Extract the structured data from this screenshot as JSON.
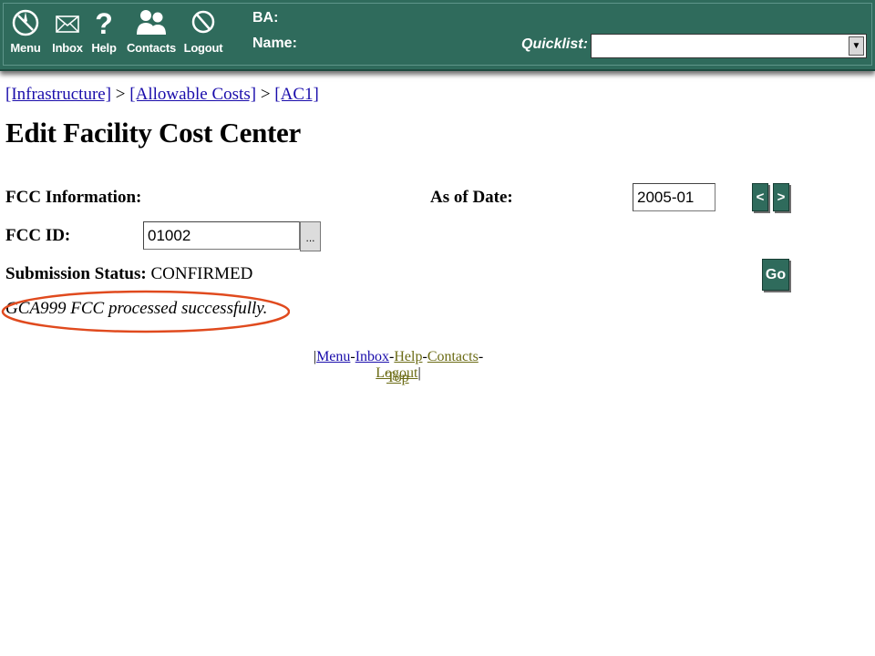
{
  "nav": {
    "items": [
      {
        "label": "Menu",
        "icon": "compass-icon"
      },
      {
        "label": "Inbox",
        "icon": "envelope-icon"
      },
      {
        "label": "Help",
        "icon": "question-icon"
      },
      {
        "label": "Contacts",
        "icon": "people-icon"
      },
      {
        "label": "Logout",
        "icon": "no-entry-icon"
      }
    ]
  },
  "header": {
    "ba_label": "BA:",
    "name_label": "Name:",
    "quicklist_label": "Quicklist:",
    "quicklist_value": ""
  },
  "breadcrumb": {
    "items": [
      "[Infrastructure]",
      "[Allowable Costs]",
      "[AC1]"
    ],
    "separator": ">"
  },
  "page": {
    "title": "Edit Facility Cost Center"
  },
  "form": {
    "fcc_info_label": "FCC Information:",
    "as_of_date_label": "As of Date:",
    "as_of_date_value": "2005-01",
    "prev_label": "<",
    "next_label": ">",
    "fcc_id_label": "FCC ID:",
    "fcc_id_value": "01002",
    "lookup_label": "...",
    "submission_status_label": "Submission Status:",
    "submission_status_value": "CONFIRMED",
    "go_label": "Go"
  },
  "message": {
    "text": "GCA999 FCC processed successfully.",
    "highlight_color": "#e04a1e"
  },
  "footer": {
    "open": "|",
    "close": "|",
    "dash": "-",
    "links": [
      "Menu",
      "Inbox",
      "Help",
      "Contacts",
      "Logout"
    ],
    "top_label": "Top"
  },
  "colors": {
    "header_bg": "#2f6b5c",
    "link_blue": "#1a0dab",
    "link_olive": "#6b6b14"
  }
}
